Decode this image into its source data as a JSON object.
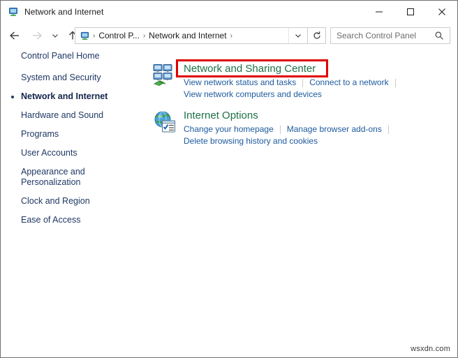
{
  "window": {
    "title": "Network and Internet",
    "title_icon": "control-panel-icon",
    "controls": {
      "minimize": "minimize-icon",
      "maximize": "maximize-icon",
      "close": "close-icon"
    }
  },
  "navbar": {
    "back": "back-arrow-icon",
    "forward": "forward-arrow-icon",
    "recent": "recent-locations-chevron-icon",
    "up": "up-arrow-icon",
    "refresh": "refresh-icon",
    "address_icon": "control-panel-icon",
    "breadcrumbs": [
      {
        "label": "Control P..."
      },
      {
        "label": "Network and Internet"
      }
    ],
    "dropdown": "chevron-down-icon"
  },
  "search": {
    "placeholder": "Search Control Panel",
    "value": "",
    "icon": "search-icon"
  },
  "sidebar": {
    "items": [
      {
        "label": "Control Panel Home",
        "current": false,
        "gap": true
      },
      {
        "label": "System and Security",
        "current": false,
        "gap": false
      },
      {
        "label": "Network and Internet",
        "current": true,
        "gap": false
      },
      {
        "label": "Hardware and Sound",
        "current": false,
        "gap": false
      },
      {
        "label": "Programs",
        "current": false,
        "gap": false
      },
      {
        "label": "User Accounts",
        "current": false,
        "gap": false
      },
      {
        "label": "Appearance and\nPersonalization",
        "current": false,
        "gap": false
      },
      {
        "label": "Clock and Region",
        "current": false,
        "gap": false
      },
      {
        "label": "Ease of Access",
        "current": false,
        "gap": false
      }
    ]
  },
  "main": {
    "categories": [
      {
        "icon": "network-sharing-center-icon",
        "title": "Network and Sharing Center",
        "highlighted": true,
        "highlight_color": "#e00000",
        "rows": [
          {
            "links": [
              "View network status and tasks",
              "Connect to a network"
            ],
            "trailing_separator": true
          },
          {
            "links": [
              "View network computers and devices"
            ],
            "trailing_separator": false
          }
        ]
      },
      {
        "icon": "internet-options-icon",
        "title": "Internet Options",
        "highlighted": false,
        "rows": [
          {
            "links": [
              "Change your homepage",
              "Manage browser add-ons"
            ],
            "trailing_separator": true
          },
          {
            "links": [
              "Delete browsing history and cookies"
            ],
            "trailing_separator": false
          }
        ]
      }
    ]
  },
  "watermark": {
    "text": "wsxdn.com"
  },
  "colors": {
    "heading_green": "#1e7145",
    "link_blue": "#1d5a9e",
    "sidebar_navy": "#1f3864",
    "highlight_red": "#e00000"
  }
}
